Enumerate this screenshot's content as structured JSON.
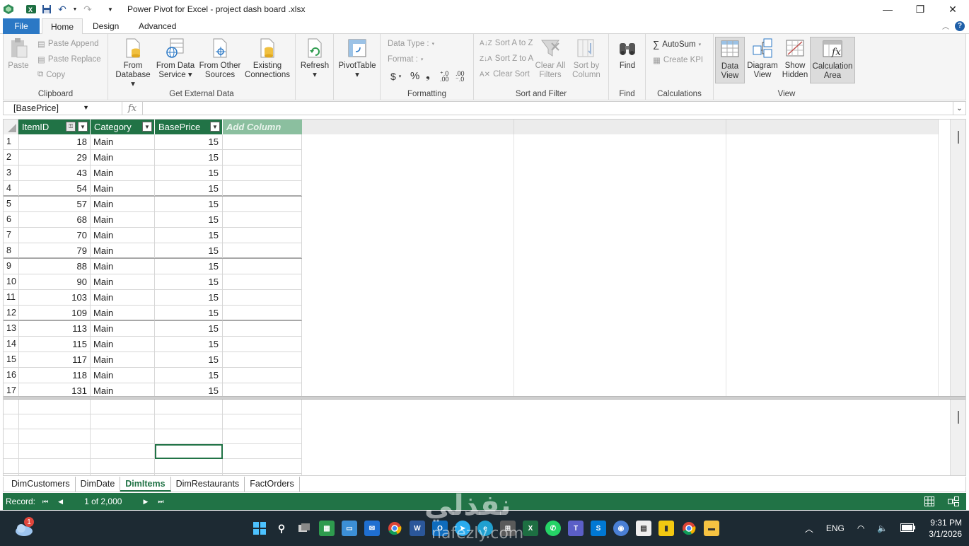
{
  "window": {
    "title": "Power Pivot for Excel - project dash board  .xlsx",
    "minimize": "—",
    "maximize": "❐",
    "close": "✕"
  },
  "tabs": {
    "file": "File",
    "home": "Home",
    "design": "Design",
    "advanced": "Advanced"
  },
  "ribbon": {
    "clipboard": {
      "label": "Clipboard",
      "paste": "Paste",
      "paste_append": "Paste Append",
      "paste_replace": "Paste Replace",
      "copy": "Copy"
    },
    "external": {
      "label": "Get External Data",
      "from_database_1": "From",
      "from_database_2": "Database",
      "from_data_service_1": "From Data",
      "from_data_service_2": "Service",
      "from_other_1": "From Other",
      "from_other_2": "Sources",
      "existing_1": "Existing",
      "existing_2": "Connections"
    },
    "refresh": "Refresh",
    "pivottable": "PivotTable",
    "formatting": {
      "label": "Formatting",
      "data_type": "Data Type :",
      "format": "Format :",
      "currency": "$",
      "percent": "%",
      "comma": "❟",
      "inc_dec": "⁺.0 .00",
      "dec_dec": ".00 ⁻.0"
    },
    "sortfilter": {
      "label": "Sort and Filter",
      "sort_az": "Sort A to Z",
      "sort_za": "Sort Z to A",
      "clear_sort": "Clear Sort",
      "clear_all_1": "Clear All",
      "clear_all_2": "Filters",
      "sort_by_1": "Sort by",
      "sort_by_2": "Column"
    },
    "find": {
      "label": "Find",
      "button": "Find"
    },
    "calculations": {
      "label": "Calculations",
      "autosum": "AutoSum",
      "create_kpi": "Create KPI"
    },
    "view": {
      "label": "View",
      "data_view_1": "Data",
      "data_view_2": "View",
      "diagram_1": "Diagram",
      "diagram_2": "View",
      "show_hidden_1": "Show",
      "show_hidden_2": "Hidden",
      "calc_area_1": "Calculation",
      "calc_area_2": "Area"
    }
  },
  "formula_bar": {
    "name_box": "[BasePrice]",
    "fx": "fx",
    "value": ""
  },
  "table": {
    "columns": [
      "ItemID",
      "Category",
      "BasePrice",
      "Add Column"
    ],
    "rows": [
      {
        "n": "1",
        "id": "18",
        "cat": "Main",
        "price": "15"
      },
      {
        "n": "2",
        "id": "29",
        "cat": "Main",
        "price": "15"
      },
      {
        "n": "3",
        "id": "43",
        "cat": "Main",
        "price": "15"
      },
      {
        "n": "4",
        "id": "54",
        "cat": "Main",
        "price": "15"
      },
      {
        "n": "5",
        "id": "57",
        "cat": "Main",
        "price": "15"
      },
      {
        "n": "6",
        "id": "68",
        "cat": "Main",
        "price": "15"
      },
      {
        "n": "7",
        "id": "70",
        "cat": "Main",
        "price": "15"
      },
      {
        "n": "8",
        "id": "79",
        "cat": "Main",
        "price": "15"
      },
      {
        "n": "9",
        "id": "88",
        "cat": "Main",
        "price": "15"
      },
      {
        "n": "10",
        "id": "90",
        "cat": "Main",
        "price": "15"
      },
      {
        "n": "11",
        "id": "103",
        "cat": "Main",
        "price": "15"
      },
      {
        "n": "12",
        "id": "109",
        "cat": "Main",
        "price": "15"
      },
      {
        "n": "13",
        "id": "113",
        "cat": "Main",
        "price": "15"
      },
      {
        "n": "14",
        "id": "115",
        "cat": "Main",
        "price": "15"
      },
      {
        "n": "15",
        "id": "117",
        "cat": "Main",
        "price": "15"
      },
      {
        "n": "16",
        "id": "118",
        "cat": "Main",
        "price": "15"
      },
      {
        "n": "17",
        "id": "131",
        "cat": "Main",
        "price": "15"
      }
    ]
  },
  "sheets": [
    "DimCustomers",
    "DimDate",
    "DimItems",
    "DimRestaurants",
    "FactOrders"
  ],
  "active_sheet": "DimItems",
  "status": {
    "record_label": "Record:",
    "position": "1 of 2,000"
  },
  "taskbar": {
    "lang": "ENG",
    "time": "9:31 PM",
    "date": "3/1/2026",
    "weather_badge": "1"
  },
  "watermark": {
    "arabic": "نفذلي",
    "latin": "nafezly.com"
  },
  "colors": {
    "accent_green": "#217346",
    "file_tab_blue": "#2b78c5",
    "taskbar": "#1d2a33"
  }
}
